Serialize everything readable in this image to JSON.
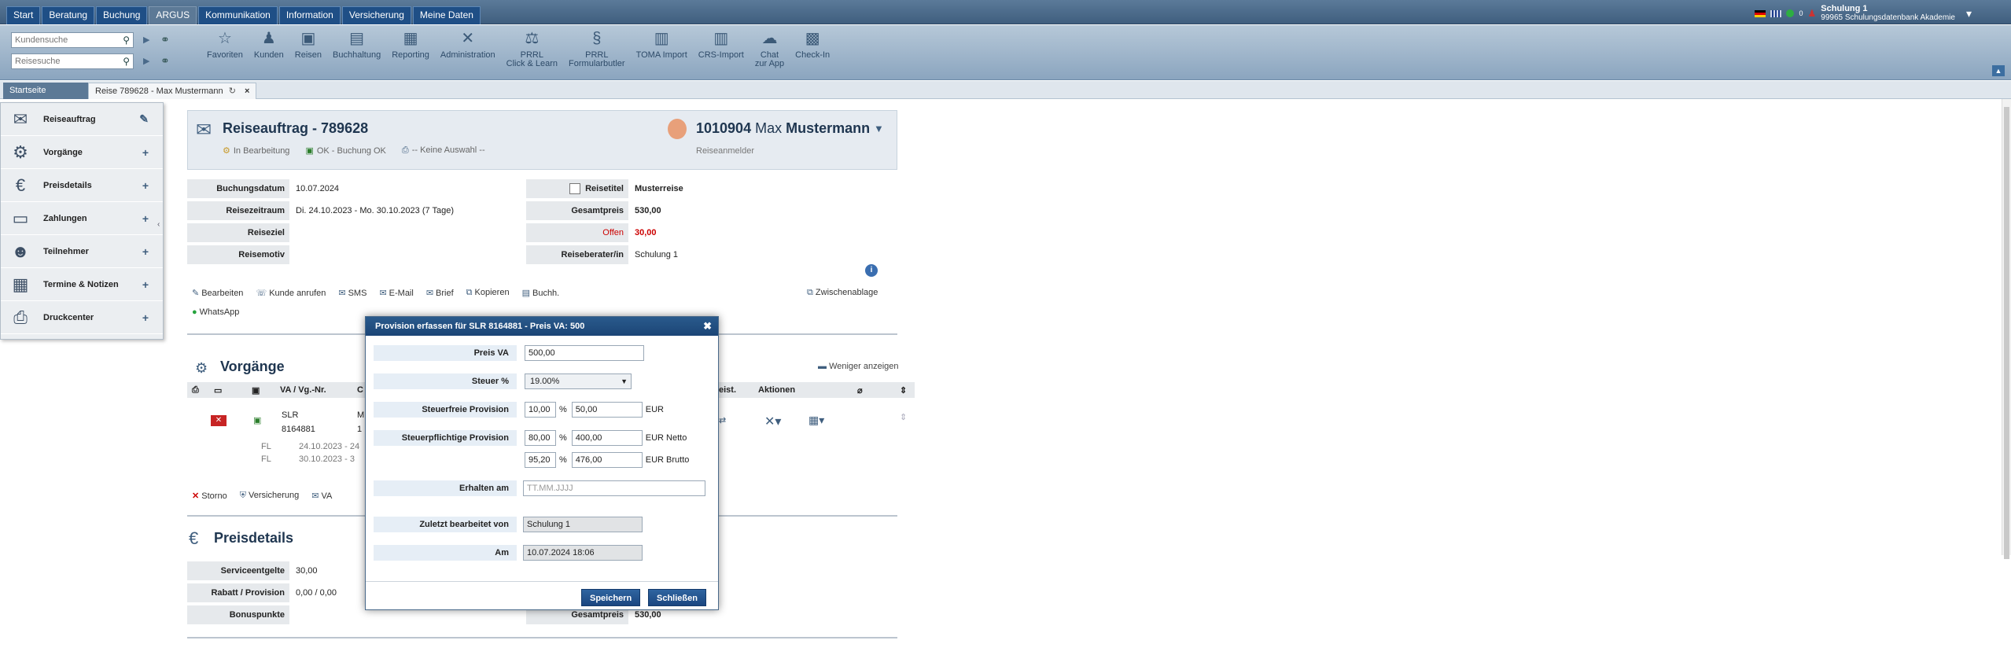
{
  "topnav": {
    "tabs": [
      "Start",
      "Beratung",
      "Buchung",
      "ARGUS",
      "Kommunikation",
      "Information",
      "Versicherung",
      "Meine Daten"
    ],
    "active": "ARGUS"
  },
  "user": {
    "name": "Schulung 1",
    "org": "99965 Schulungsdatenbank Akademie",
    "badge": "0"
  },
  "search": {
    "customer_placeholder": "Kundensuche",
    "trip_placeholder": "Reisesuche"
  },
  "toolbar": [
    {
      "label": "Favoriten",
      "icon": "star-icon"
    },
    {
      "label": "Kunden",
      "icon": "person-icon"
    },
    {
      "label": "Reisen",
      "icon": "suitcase-icon"
    },
    {
      "label": "Buchhaltung",
      "icon": "book-icon"
    },
    {
      "label": "Reporting",
      "icon": "report-icon"
    },
    {
      "label": "Administration",
      "icon": "tools-icon"
    },
    {
      "label": "PRRL\nClick & Learn",
      "icon": "law-icon"
    },
    {
      "label": "PRRL\nFormularbutler",
      "icon": "paragraph-icon"
    },
    {
      "label": "TOMA Import",
      "icon": "import-icon"
    },
    {
      "label": "CRS-Import",
      "icon": "crs-icon"
    },
    {
      "label": "Chat\nzur App",
      "icon": "chat-icon"
    },
    {
      "label": "Check-In",
      "icon": "checkin-icon"
    }
  ],
  "tabs": {
    "home": "Startseite",
    "doc": "Reise 789628 - Max Mustermann"
  },
  "sidebar": [
    {
      "label": "Reiseauftrag",
      "action": "✎"
    },
    {
      "label": "Vorgänge",
      "action": "+"
    },
    {
      "label": "Preisdetails",
      "action": "+"
    },
    {
      "label": "Zahlungen",
      "action": "+"
    },
    {
      "label": "Teilnehmer",
      "action": "+"
    },
    {
      "label": "Termine & Notizen",
      "action": "+"
    },
    {
      "label": "Druckcenter",
      "action": "+"
    }
  ],
  "header": {
    "title": "Reiseauftrag - 789628",
    "status": [
      "In Bearbeitung",
      "OK - Buchung OK",
      "-- Keine Auswahl --"
    ],
    "customer_number": "1010904",
    "customer_first": "Max",
    "customer_last": "Mustermann",
    "customer_role": "Reiseanmelder"
  },
  "left_fields": [
    {
      "label": "Buchungsdatum",
      "value": "10.07.2024"
    },
    {
      "label": "Reisezeitraum",
      "value": "Di. 24.10.2023 - Mo. 30.10.2023 (7 Tage)"
    },
    {
      "label": "Reiseziel",
      "value": ""
    },
    {
      "label": "Reisemotiv",
      "value": ""
    }
  ],
  "right_fields": [
    {
      "label": "Reisetitel",
      "value": "Musterreise"
    },
    {
      "label": "Gesamtpreis",
      "value": "530,00"
    },
    {
      "label": "Offen",
      "value": "30,00"
    },
    {
      "label": "Reiseberater/in",
      "value": "Schulung 1"
    }
  ],
  "actions": [
    "Bearbeiten",
    "Kunde anrufen",
    "SMS",
    "E-Mail",
    "Brief",
    "Kopieren",
    "Buchh."
  ],
  "whatsapp": "WhatsApp",
  "clipboard": "Zwischenablage",
  "vorgaenge": {
    "title": "Vorgänge",
    "less": "Weniger anzeigen",
    "headers": {
      "va": "VA / Vg.-Nr.",
      "c": "C",
      "leist": "eist.",
      "aktionen": "Aktionen"
    },
    "row": {
      "va": "SLR",
      "nr": "8164881",
      "c1": "M",
      "c2": "1"
    },
    "flights": [
      {
        "code": "FL",
        "date": "24.10.2023 - 24"
      },
      {
        "code": "FL",
        "date": "30.10.2023 - 3"
      }
    ],
    "footer": [
      "Storno",
      "Versicherung",
      "VA"
    ]
  },
  "preisdetails": {
    "title": "Preisdetails",
    "fields": [
      {
        "label": "Serviceentgelte",
        "value": "30,00"
      },
      {
        "label": "Rabatt / Provision",
        "value": "0,00 / 0,00"
      },
      {
        "label": "Bonuspunkte",
        "value": ""
      }
    ],
    "right_label": "Gesamtpreis",
    "right_value": "530,00"
  },
  "modal": {
    "title": "Provision erfassen für SLR 8164881 - Preis VA: 500",
    "preis_va_label": "Preis VA",
    "preis_va": "500,00",
    "steuer_label": "Steuer %",
    "steuer": "19.00%",
    "steuerfrei_label": "Steuerfreie Provision",
    "steuerfrei_pct": "10,00",
    "steuerfrei_amt": "50,00",
    "steuerpflichtig_label": "Steuerpflichtige Provision",
    "netto_pct": "80,00",
    "netto_amt": "400,00",
    "brutto_pct": "95,20",
    "brutto_amt": "476,00",
    "pct_sign": "%",
    "eur": "EUR",
    "eur_netto": "EUR Netto",
    "eur_brutto": "EUR Brutto",
    "erhalten_label": "Erhalten am",
    "erhalten_placeholder": "TT.MM.JJJJ",
    "zuletzt_label": "Zuletzt bearbeitet von",
    "zuletzt": "Schulung 1",
    "am_label": "Am",
    "am": "10.07.2024 18:06",
    "save": "Speichern",
    "close": "Schließen"
  },
  "colors": {
    "accent": "#1b4576",
    "nav": "#1f4f86",
    "danger": "#cc0000"
  }
}
